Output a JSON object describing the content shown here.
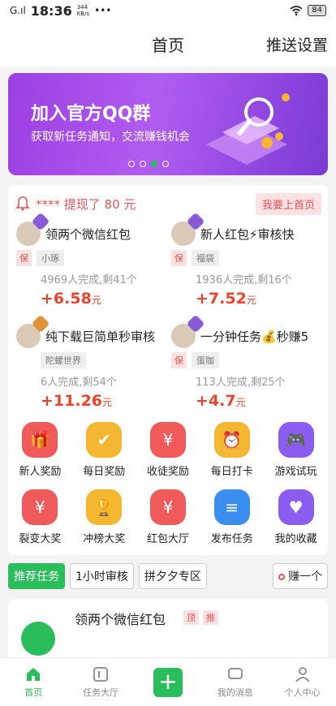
{
  "status_bar": {
    "time": "18:36",
    "speed_top": "344",
    "speed_bottom": "KB/s",
    "dots": "•••",
    "battery": "84"
  },
  "header": {
    "title": "首页",
    "push_settings": "推送设置"
  },
  "banner": {
    "title": "加入官方QQ群",
    "subtitle": "获取新任务通知，交流赚钱机会",
    "dot_count": 4,
    "active_dot": 2,
    "bg_color": "#9b3fe3"
  },
  "withdraw": {
    "text": "**** 提现了 80 元",
    "button": "我要上首页"
  },
  "tasks": [
    {
      "name": "领两个微信红包",
      "bao": "保",
      "user": "小琢",
      "progress": "4969人完成,剩41个",
      "reward": "+6.58",
      "unit": "元"
    },
    {
      "name": "新人红包⚡审核快",
      "bao": "保",
      "user": "福袋",
      "progress": "1936人完成,剩16个",
      "reward": "+7.52",
      "unit": "元"
    },
    {
      "name": "纯下载巨简单秒审核",
      "bao": "",
      "user": "陀螺世界",
      "progress": "6人完成,剩54个",
      "reward": "+11.26",
      "unit": "元"
    },
    {
      "name": "一分钟任务💰秒赚5",
      "bao": "保",
      "user": "蛋咖",
      "progress": "113人完成,剩25个",
      "reward": "+4.7",
      "unit": "元"
    }
  ],
  "icons": [
    {
      "label": "新人奖励",
      "icon": "gift-icon",
      "color": "#f05a5a"
    },
    {
      "label": "每日奖励",
      "icon": "check-box-icon",
      "color": "#f5b731"
    },
    {
      "label": "收徒奖励",
      "icon": "money-bag-icon",
      "color": "#f05a5a"
    },
    {
      "label": "每日打卡",
      "icon": "alarm-clock-icon",
      "color": "#f5b731"
    },
    {
      "label": "游戏试玩",
      "icon": "gamepad-icon",
      "color": "#8b5cf0"
    },
    {
      "label": "裂变大奖",
      "icon": "red-packet-icon",
      "color": "#f05a5a"
    },
    {
      "label": "冲榜大奖",
      "icon": "trophy-icon",
      "color": "#f5b731"
    },
    {
      "label": "红包大厅",
      "icon": "red-packet-icon",
      "color": "#f05a5a"
    },
    {
      "label": "发布任务",
      "icon": "publish-icon",
      "color": "#3a8ef0"
    },
    {
      "label": "我的收藏",
      "icon": "heart-icon",
      "color": "#8b5cf0"
    }
  ],
  "tabs": {
    "recommend": "推荐任务",
    "one_hour": "1小时审核",
    "pdd": "拼夕夕专区",
    "earn": "赚一个"
  },
  "list_item": {
    "name": "领两个微信红包",
    "tag_top": "顶",
    "tag_recommend": "推"
  },
  "bottom_nav": {
    "home": "首页",
    "hall": "任务大厅",
    "messages": "我的消息",
    "profile": "个人中心"
  },
  "colors": {
    "accent": "#2bbd5c",
    "red": "#e8442e"
  }
}
